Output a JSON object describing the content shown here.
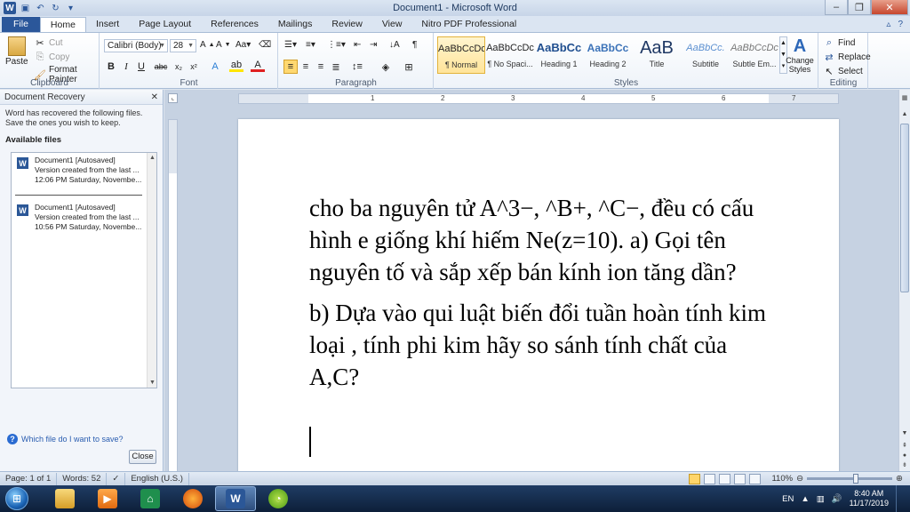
{
  "window": {
    "title": "Document1 - Microsoft Word"
  },
  "tabs": [
    "File",
    "Home",
    "Insert",
    "Page Layout",
    "References",
    "Mailings",
    "Review",
    "View",
    "Nitro PDF Professional"
  ],
  "ribbon": {
    "clipboard": {
      "paste": "Paste",
      "cut": "Cut",
      "copy": "Copy",
      "format_painter": "Format Painter",
      "label": "Clipboard"
    },
    "font": {
      "family": "Calibri (Body)",
      "size": "28",
      "label": "Font"
    },
    "paragraph": {
      "label": "Paragraph"
    },
    "styles": {
      "label": "Styles",
      "items": [
        {
          "sample": "AaBbCcDc",
          "name": "¶ Normal"
        },
        {
          "sample": "AaBbCcDc",
          "name": "¶ No Spaci..."
        },
        {
          "sample": "AaBbCc",
          "name": "Heading 1"
        },
        {
          "sample": "AaBbCc",
          "name": "Heading 2"
        },
        {
          "sample": "AaB",
          "name": "Title"
        },
        {
          "sample": "AaBbCc.",
          "name": "Subtitle"
        },
        {
          "sample": "AaBbCcDc",
          "name": "Subtle Em..."
        }
      ],
      "change_styles": "Change Styles"
    },
    "editing": {
      "find": "Find",
      "replace": "Replace",
      "select": "Select",
      "label": "Editing"
    }
  },
  "recovery": {
    "title": "Document Recovery",
    "message": "Word has recovered the following files.  Save the ones you wish to keep.",
    "available_label": "Available files",
    "files": [
      {
        "name": "Document1  [Autosaved]",
        "line2": "Version created from the last ...",
        "line3": "12:06 PM Saturday, Novembe..."
      },
      {
        "name": "Document1  [Autosaved]",
        "line2": "Version created from the last ...",
        "line3": "10:56 PM Saturday, Novembe..."
      }
    ],
    "help": "Which file do I want to save?",
    "close": "Close"
  },
  "document": {
    "paragraphs": [
      "cho ba nguyên  tử A^3−, ^B+, ^C−, đều có cấu hình e giống khí hiếm Ne(z=10). a) Gọi tên nguyên  tố và sắp xếp bán kính ion tăng dần?",
      "b) Dựa vào qui luật biến đổi tuần hoàn tính kim loại , tính phi kim hãy so sánh tính chất của A,C?"
    ]
  },
  "ruler": {
    "numbers": [
      "1",
      "2",
      "3",
      "4",
      "5",
      "6",
      "7"
    ]
  },
  "status": {
    "page": "Page: 1 of 1",
    "words": "Words: 52",
    "language": "English (U.S.)",
    "zoom": "110%"
  },
  "taskbar": {
    "lang": "EN",
    "time": "8:40 AM",
    "date": "11/17/2019"
  }
}
